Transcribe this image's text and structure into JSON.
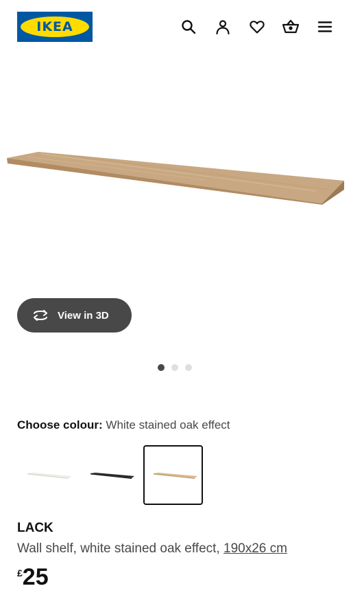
{
  "header": {
    "logo_text": "IKEA",
    "icons": [
      "search-icon",
      "profile-icon",
      "heart-icon",
      "basket-icon",
      "menu-icon"
    ]
  },
  "hero": {
    "view3d_label": "View in 3D",
    "carousel_total": 3,
    "carousel_active": 1
  },
  "colour": {
    "label": "Choose colour:",
    "selected_value": "White stained oak effect",
    "swatches": [
      {
        "colour": "#f1efe9",
        "selected": false
      },
      {
        "colour": "#1b1b1b",
        "selected": false
      },
      {
        "colour": "#d9b990",
        "selected": true
      }
    ]
  },
  "product": {
    "name": "LACK",
    "description": "Wall shelf, white stained oak effect, ",
    "size": "190x26 cm",
    "price_currency": "£",
    "price_amount": "25"
  },
  "colors": {
    "brand_blue": "#0058a3",
    "brand_yellow": "#ffdb00",
    "button_dark": "#484848"
  }
}
